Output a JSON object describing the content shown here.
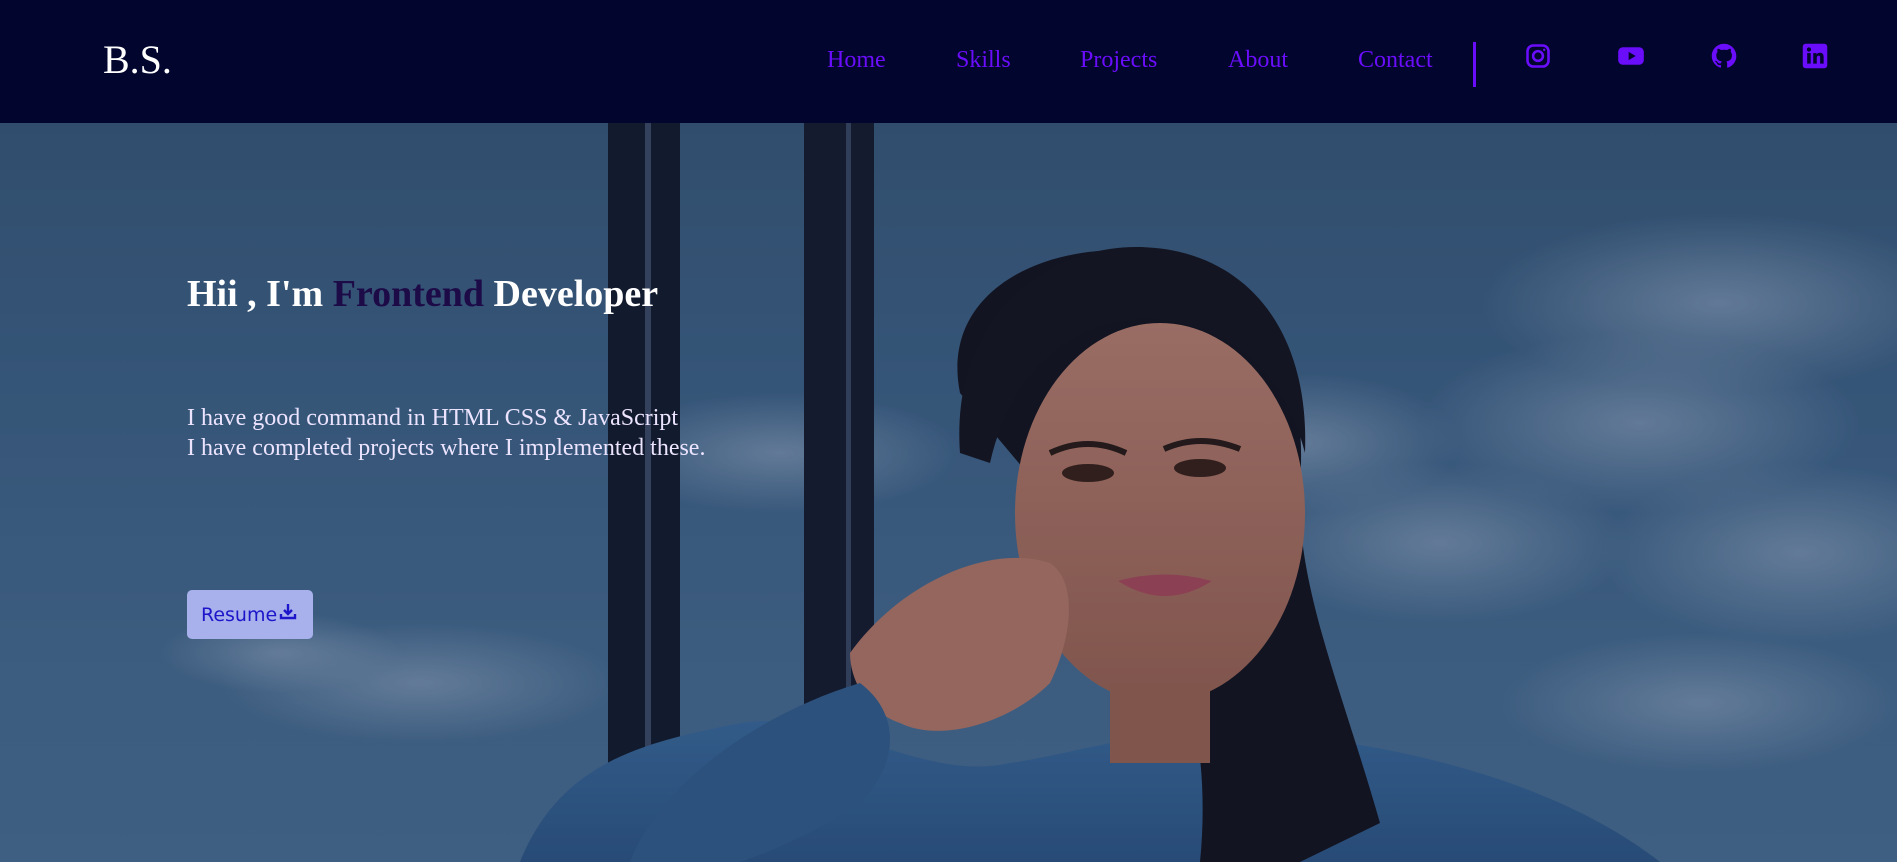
{
  "brand": {
    "logo": "B.S."
  },
  "nav": {
    "items": [
      {
        "label": "Home"
      },
      {
        "label": "Skills"
      },
      {
        "label": "Projects"
      },
      {
        "label": "About"
      },
      {
        "label": "Contact"
      }
    ]
  },
  "social": {
    "icons": [
      "instagram-icon",
      "youtube-icon",
      "github-icon",
      "linkedin-icon"
    ]
  },
  "hero": {
    "greeting": "Hii , I'm",
    "highlight": "Frontend",
    "role": "Developer",
    "line1": "I have good command in HTML CSS & JavaScript",
    "line2": "I have completed projects where I implemented these.",
    "resume_label": "Resume"
  },
  "colors": {
    "nav_bg": "#02052e",
    "accent_purple": "#6a0dfa",
    "highlight_text": "#1d0b48",
    "button_bg": "#a8b1ec",
    "button_text": "#1c15c9"
  }
}
